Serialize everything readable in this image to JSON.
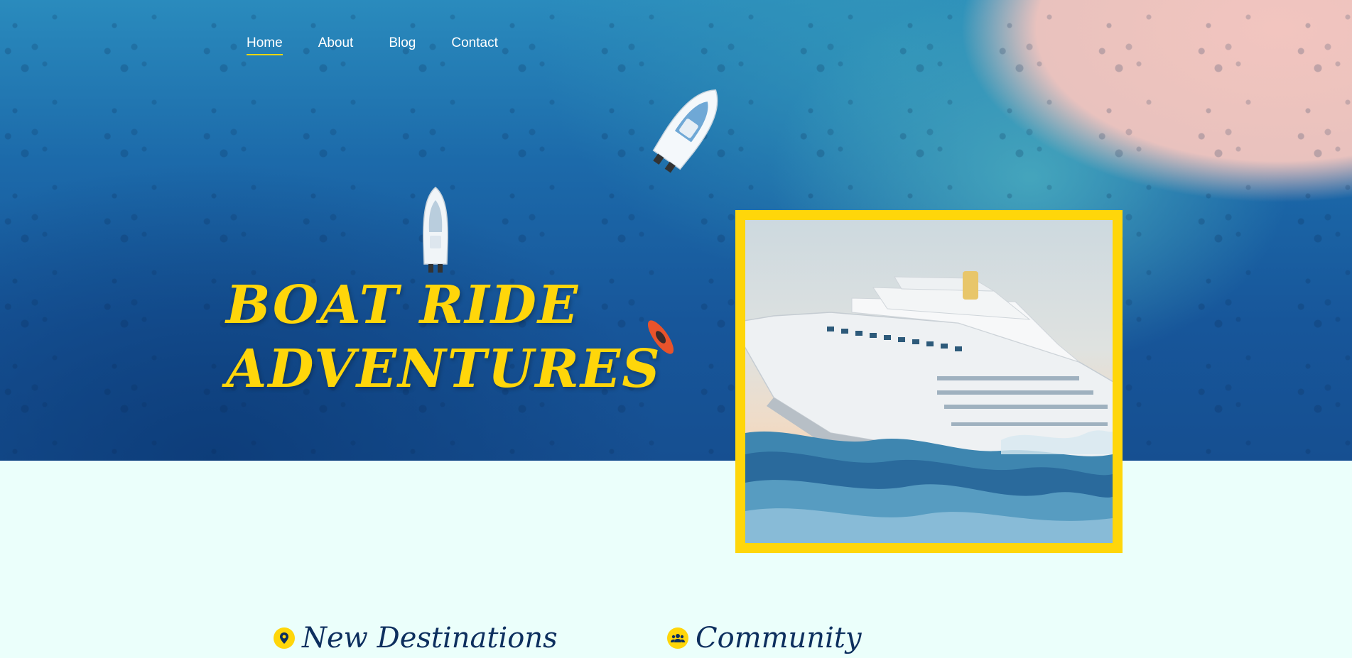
{
  "nav": {
    "items": [
      {
        "label": "Home",
        "active": true
      },
      {
        "label": "About",
        "active": false
      },
      {
        "label": "Blog",
        "active": false
      },
      {
        "label": "Contact",
        "active": false
      }
    ]
  },
  "hero": {
    "title_line1": "BOAT RIDE",
    "title_line2": "ADVENTURES"
  },
  "features": [
    {
      "label": "New Destinations",
      "icon": "map-pin-icon"
    },
    {
      "label": "Community",
      "icon": "people-icon"
    }
  ],
  "colors": {
    "accent": "#ffd60a",
    "heading": "#0d2f5e",
    "page_bg": "#ebfffb"
  }
}
